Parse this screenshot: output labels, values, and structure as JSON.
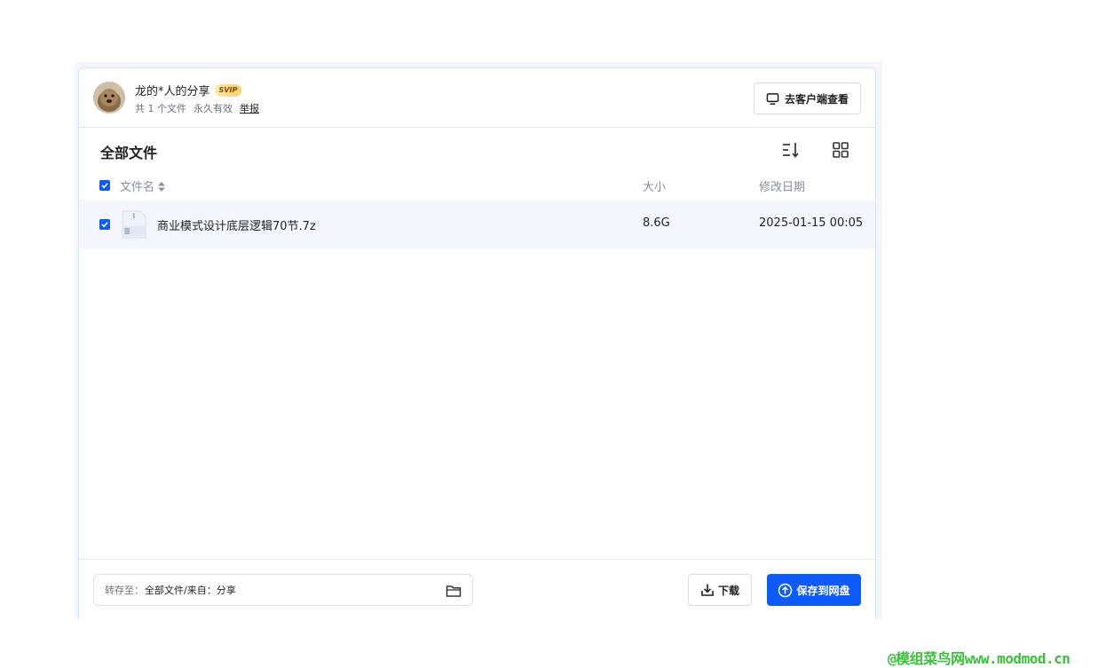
{
  "header": {
    "owner_name": "龙的*人的分享",
    "badge": "SVIP",
    "file_count": "共 1 个文件",
    "validity": "永久有效",
    "report_label": "举报",
    "client_button_label": "去客户端查看"
  },
  "file_list": {
    "title": "全部文件",
    "columns": {
      "name": "文件名",
      "size": "大小",
      "modified": "修改日期"
    },
    "rows": [
      {
        "name": "商业模式设计底层逻辑70节.7z",
        "size": "8.6G",
        "modified": "2025-01-15 00:05",
        "checked": true
      }
    ],
    "select_all_checked": true
  },
  "footer": {
    "save_to_label": "转存至：",
    "save_to_value": "全部文件/来自：分享",
    "download_label": "下载",
    "save_label": "保存到网盘"
  },
  "watermark": "@模组菜鸟网www.modmod.cn",
  "colors": {
    "accent": "#0d5bff",
    "row_highlight": "#f4f6fd",
    "watermark": "#3dbf3d"
  },
  "icons": [
    "monitor-icon",
    "sort-icon",
    "grid-view-icon",
    "sort-arrows-icon",
    "zip-file-icon",
    "folder-icon",
    "download-icon",
    "cloud-upload-icon",
    "checkbox-checked-icon"
  ]
}
